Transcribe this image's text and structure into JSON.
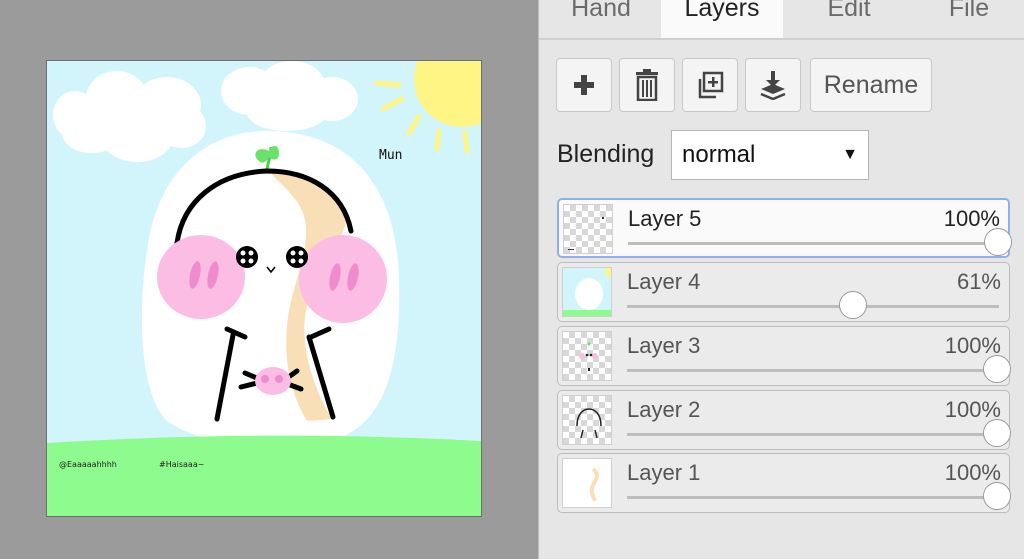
{
  "tabs": [
    {
      "label": "Hand"
    },
    {
      "label": "Layers",
      "active": true
    },
    {
      "label": "Edit"
    },
    {
      "label": "File"
    }
  ],
  "toolbar": {
    "add_icon": "plus-icon",
    "delete_icon": "trash-icon",
    "duplicate_icon": "duplicate-icon",
    "merge_icon": "merge-down-icon",
    "rename_label": "Rename"
  },
  "blending": {
    "label": "Blending",
    "value": "normal"
  },
  "layers": [
    {
      "name": "Layer 5",
      "opacity_label": "100%",
      "opacity": 1.0,
      "selected": true
    },
    {
      "name": "Layer 4",
      "opacity_label": "61%",
      "opacity": 0.61,
      "selected": false
    },
    {
      "name": "Layer 3",
      "opacity_label": "100%",
      "opacity": 1.0,
      "selected": false
    },
    {
      "name": "Layer 2",
      "opacity_label": "100%",
      "opacity": 1.0,
      "selected": false
    },
    {
      "name": "Layer 1",
      "opacity_label": "100%",
      "opacity": 1.0,
      "selected": false
    }
  ],
  "drawing": {
    "text_mun": "Mun",
    "signature_left": "@Eaaaaahhhh",
    "signature_right": "#Haisaaa~"
  },
  "colors": {
    "sky": "#d2f5fb",
    "grass": "#8efb8e",
    "sun": "#fff585",
    "cheek": "#fbbde4",
    "selected_border": "#8fb0ea"
  }
}
